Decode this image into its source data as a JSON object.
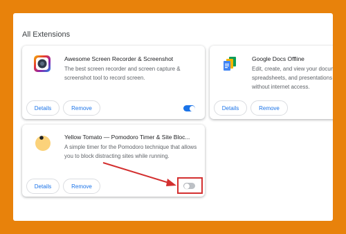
{
  "section": {
    "title": "All Extensions"
  },
  "extensions": [
    {
      "name": "Awesome Screen Recorder & Screenshot",
      "description": "The best screen recorder and screen capture & screenshot tool to record screen.",
      "details_label": "Details",
      "remove_label": "Remove",
      "enabled": true,
      "icon": "screen-recorder-icon"
    },
    {
      "name": "Google Docs Offline",
      "description": "Edit, create, and view your documents, spreadsheets, and presentations — all without internet access.",
      "details_label": "Details",
      "remove_label": "Remove",
      "enabled": true,
      "icon": "google-docs-offline-icon"
    },
    {
      "name": "Yellow Tomato — Pomodoro Timer & Site Bloc...",
      "description": "A simple timer for the Pomodoro technique that allows you to block distracting sites while running.",
      "details_label": "Details",
      "remove_label": "Remove",
      "enabled": false,
      "icon": "yellow-tomato-icon"
    }
  ],
  "colors": {
    "background": "#e8820b",
    "toggle_on": "#1a73e8",
    "toggle_off": "#bdc1c6",
    "annotation": "#d32f2f",
    "button_text": "#1a73e8"
  }
}
